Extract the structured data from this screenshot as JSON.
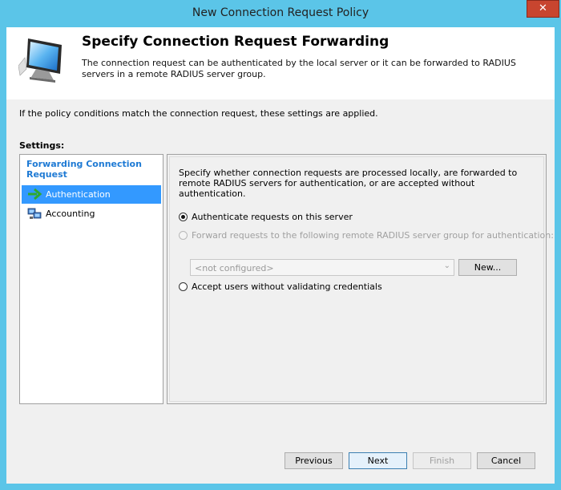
{
  "window": {
    "title": "New Connection Request Policy",
    "close_label": "✕"
  },
  "header": {
    "title": "Specify Connection Request Forwarding",
    "description": "The connection request can be authenticated by the local server or it can be forwarded to RADIUS servers in a remote RADIUS server group.",
    "icon": "monitor-icon"
  },
  "conditions_text": "If the policy conditions match the connection request, these settings are applied.",
  "settings_label": "Settings:",
  "left_panel": {
    "heading": "Forwarding Connection Request",
    "items": [
      {
        "label": "Authentication",
        "icon": "green-arrow-icon",
        "selected": true
      },
      {
        "label": "Accounting",
        "icon": "computer-network-icon",
        "selected": false
      }
    ]
  },
  "right_panel": {
    "description": "Specify whether connection requests are processed locally, are forwarded to remote RADIUS servers for authentication, or are accepted without authentication.",
    "options": [
      {
        "label": "Authenticate requests on this server",
        "checked": true,
        "enabled": true
      },
      {
        "label": "Forward requests to the following remote RADIUS server group for authentication:",
        "checked": false,
        "enabled": false
      },
      {
        "label": "Accept users without validating credentials",
        "checked": false,
        "enabled": true
      }
    ],
    "group_select": {
      "value": "<not configured>"
    },
    "new_button": "New..."
  },
  "buttons": {
    "previous": "Previous",
    "next": "Next",
    "finish": "Finish",
    "cancel": "Cancel"
  },
  "colors": {
    "title_bar": "#5bc5e8",
    "close_button": "#c8452f",
    "selection": "#3399ff",
    "link_heading": "#1e7ad4"
  }
}
